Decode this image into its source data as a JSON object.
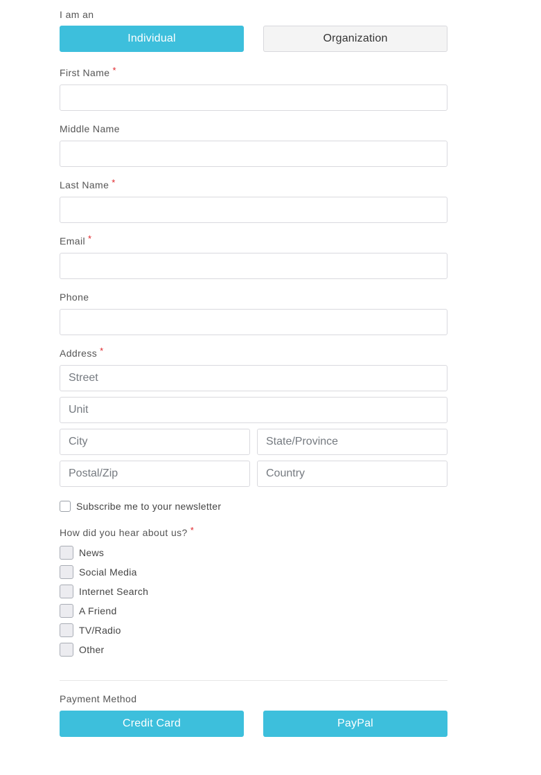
{
  "entity_type": {
    "label": "I am an",
    "options": [
      {
        "label": "Individual",
        "selected": true
      },
      {
        "label": "Organization",
        "selected": false
      }
    ]
  },
  "fields": {
    "first_name": {
      "label": "First Name",
      "required": "*",
      "value": "",
      "placeholder": ""
    },
    "middle_name": {
      "label": "Middle Name",
      "value": "",
      "placeholder": ""
    },
    "last_name": {
      "label": "Last Name",
      "required": "*",
      "value": "",
      "placeholder": ""
    },
    "email": {
      "label": "Email",
      "required": "*",
      "value": "",
      "placeholder": ""
    },
    "phone": {
      "label": "Phone",
      "value": "",
      "placeholder": ""
    }
  },
  "address": {
    "label": "Address",
    "required": "*",
    "street": {
      "placeholder": "Street",
      "value": ""
    },
    "unit": {
      "placeholder": "Unit",
      "value": ""
    },
    "city": {
      "placeholder": "City",
      "value": ""
    },
    "state": {
      "placeholder": "State/Province",
      "value": ""
    },
    "postal": {
      "placeholder": "Postal/Zip",
      "value": ""
    },
    "country": {
      "placeholder": "Country",
      "value": ""
    }
  },
  "newsletter": {
    "label": "Subscribe me to your newsletter",
    "checked": false
  },
  "referral": {
    "label": "How did you hear about us?",
    "required": "*",
    "options": [
      {
        "label": "News",
        "checked": false
      },
      {
        "label": "Social Media",
        "checked": false
      },
      {
        "label": "Internet Search",
        "checked": false
      },
      {
        "label": "A Friend",
        "checked": false
      },
      {
        "label": "TV/Radio",
        "checked": false
      },
      {
        "label": "Other",
        "checked": false
      }
    ]
  },
  "payment": {
    "label": "Payment Method",
    "options": [
      {
        "label": "Credit Card"
      },
      {
        "label": "PayPal"
      }
    ]
  },
  "colors": {
    "accent": "#3dbfdc",
    "required": "#e0262b",
    "secondary_button_bg": "#f4f4f4",
    "input_border": "#d9d9de"
  }
}
